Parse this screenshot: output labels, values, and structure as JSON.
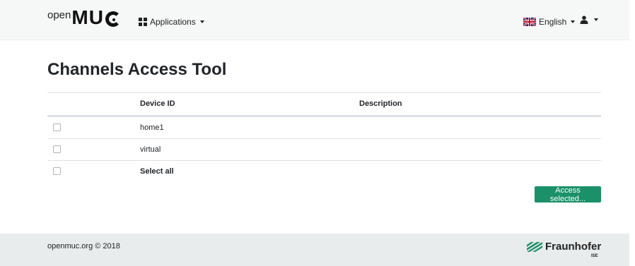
{
  "brand": {
    "prefix": "open",
    "name": "MU"
  },
  "nav": {
    "applications_label": "Applications",
    "language_label": "English"
  },
  "page": {
    "title": "Channels Access Tool"
  },
  "table": {
    "headers": {
      "device_id": "Device ID",
      "description": "Description"
    },
    "rows": [
      {
        "device_id": "home1",
        "description": ""
      },
      {
        "device_id": "virtual",
        "description": ""
      }
    ],
    "select_all_label": "Select all"
  },
  "actions": {
    "access_selected_label": "Access selected..."
  },
  "footer": {
    "copyright": "openmuc.org © 2018",
    "partner_name": "Fraunhofer",
    "partner_sub": "ISE"
  },
  "colors": {
    "accent": "#1a9168",
    "navbar_bg": "#f6f7f7",
    "footer_bg": "#e9ecec"
  }
}
